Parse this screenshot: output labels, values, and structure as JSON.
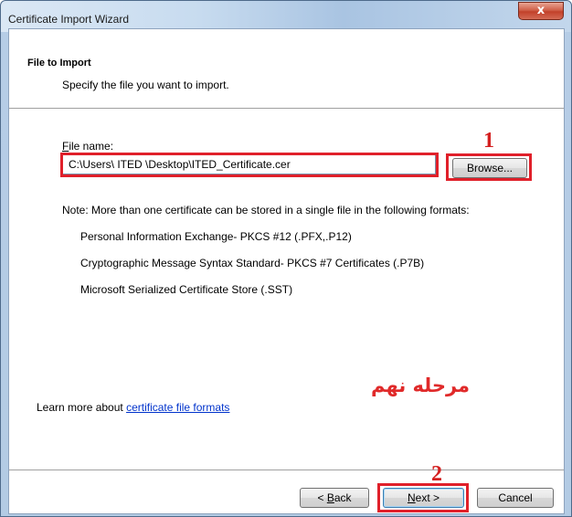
{
  "window": {
    "title": "Certificate Import Wizard",
    "close_glyph": "x"
  },
  "header": {
    "title": "File to Import",
    "subtitle": "Specify the file you want to import."
  },
  "file": {
    "label_first": "F",
    "label_rest": "ile name:",
    "value": "C:\\Users\\ ITED \\Desktop\\ITED_Certificate.cer",
    "browse_label": "Browse..."
  },
  "note": {
    "text": "Note:  More than one certificate can be stored in a single file in the following formats:",
    "formats": [
      "Personal Information Exchange- PKCS #12 (.PFX,.P12)",
      "Cryptographic Message Syntax Standard- PKCS #7 Certificates (.P7B)",
      "Microsoft Serialized Certificate Store (.SST)"
    ]
  },
  "annotations": {
    "step1": "1",
    "step2": "2",
    "farsi": "مرحله نهم",
    "highlight_color": "#e0202a"
  },
  "learn_more": {
    "prefix": "Learn more about ",
    "link": "certificate file formats"
  },
  "buttons": {
    "back_prefix": "< ",
    "back_first": "B",
    "back_rest": "ack",
    "next_first": "N",
    "next_rest": "ext >",
    "cancel": "Cancel"
  }
}
